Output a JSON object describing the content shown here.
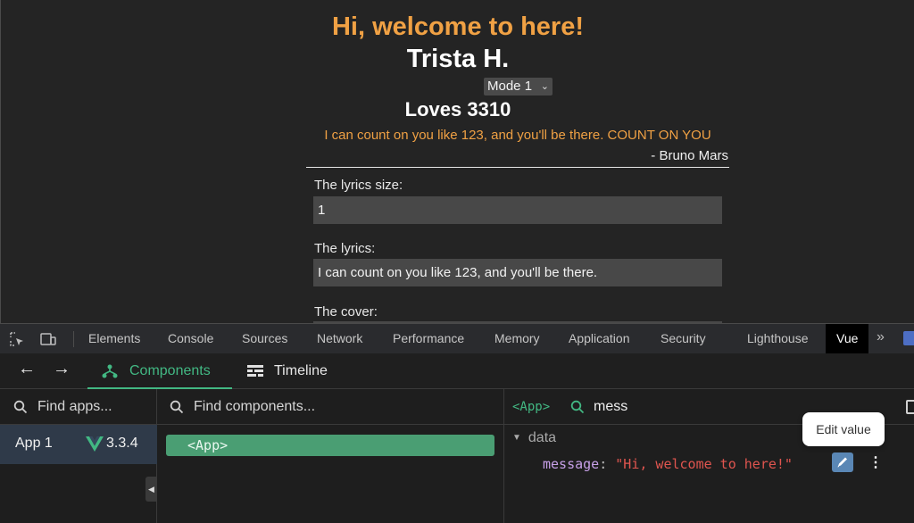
{
  "page": {
    "greeting": "Hi, welcome to here!",
    "author_name": "Trista H.",
    "mode_select": {
      "selected": "Mode 1"
    },
    "loves": "Loves 3310",
    "lyric_line": "I can count on you like 123, and you'll be there. COUNT ON YOU",
    "by_line": "- Bruno Mars",
    "fields": [
      {
        "label": "The lyrics size:",
        "value": "1"
      },
      {
        "label": "The lyrics:",
        "value": "I can count on you like 123, and you'll be there."
      },
      {
        "label": "The cover:",
        "value": ""
      }
    ],
    "colors": {
      "accent": "#f0a144",
      "background": "#242424"
    }
  },
  "devtools": {
    "tabs": [
      "Elements",
      "Console",
      "Sources",
      "Network",
      "Performance",
      "Memory",
      "Application",
      "Security",
      "Lighthouse",
      "Vue"
    ],
    "active_tab": "Vue",
    "more_tabs_icon": "double-chevron-right-icon"
  },
  "vue": {
    "nav": {
      "back_icon": "arrow-left-icon",
      "forward_icon": "arrow-right-icon",
      "components_label": "Components",
      "timeline_label": "Timeline"
    },
    "apps": {
      "search_placeholder": "Find apps...",
      "items": [
        {
          "name": "App 1",
          "version": "3.3.4"
        }
      ]
    },
    "tree": {
      "search_placeholder": "Find components...",
      "root_node": "<App>"
    },
    "inspector": {
      "component": "<App>",
      "filter_value": "mess",
      "section": "data",
      "prop_key": "message",
      "prop_value": "\"Hi, welcome to here!\"",
      "tooltip": "Edit value"
    },
    "colors": {
      "vue_green": "#42b883",
      "selected_row": "#2f3a49"
    }
  }
}
